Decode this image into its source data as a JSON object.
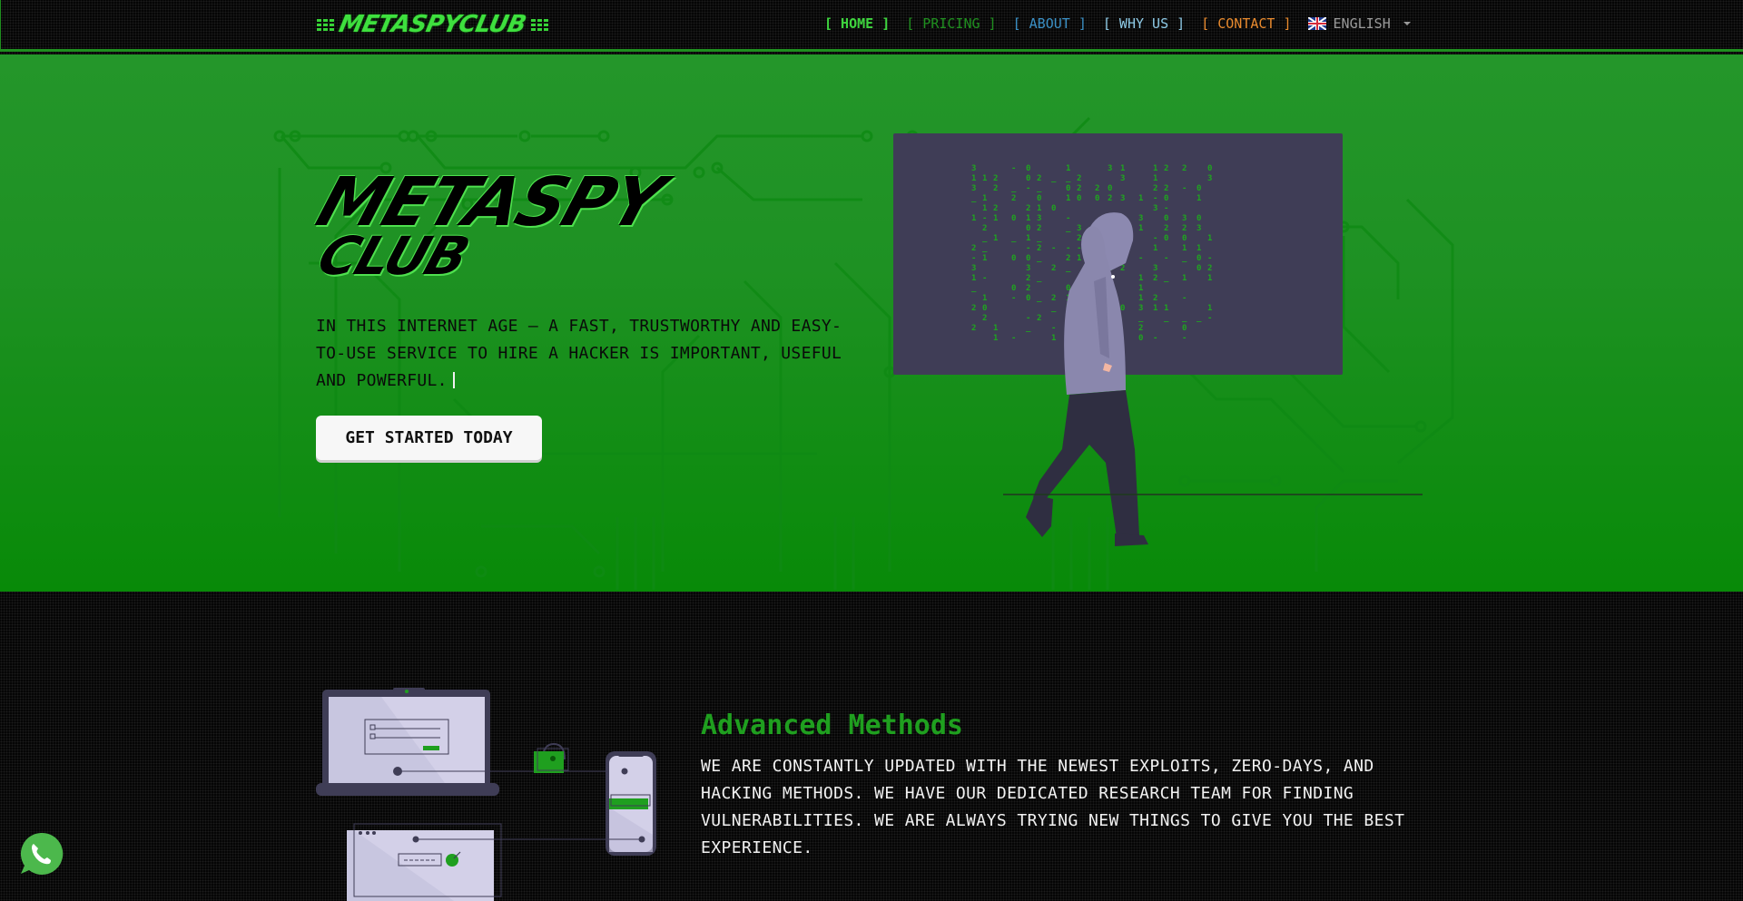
{
  "navbar": {
    "logo_text": "METASPYCLUB",
    "items": [
      {
        "label": "[ HOME ]",
        "color": "#3ed43e",
        "active": true
      },
      {
        "label": "[ PRICING ]",
        "color": "#1f8f1f"
      },
      {
        "label": "[ ABOUT ]",
        "color": "#3a8fc4"
      },
      {
        "label": "[ WHY US ]",
        "color": "#8ecae6"
      },
      {
        "label": "[ CONTACT ]",
        "color": "#e88a2e"
      }
    ],
    "language": {
      "icon": "uk-flag-icon",
      "label": "ENGLISH"
    }
  },
  "hero": {
    "logo_line1": "METASPY",
    "logo_line2": "CLUB",
    "tagline": "IN THIS INTERNET AGE – A FAST, TRUSTWORTHY AND EASY-TO-USE SERVICE TO HIRE A HACKER IS IMPORTANT, USEFUL AND POWERFUL.",
    "cta_label": "GET STARTED TODAY",
    "background_color": "#1e9123"
  },
  "features": [
    {
      "title": "Advanced Methods",
      "text": "WE ARE CONSTANTLY UPDATED WITH THE NEWEST EXPLOITS, ZERO-DAYS, AND HACKING METHODS. WE HAVE OUR DEDICATED RESEARCH TEAM FOR FINDING VULNERABILITIES. WE ARE ALWAYS TRYING NEW THINGS TO GIVE YOU THE BEST EXPERIENCE.",
      "title_color": "#1f9f1f"
    }
  ],
  "floating": {
    "whatsapp_icon": "whatsapp-icon",
    "color": "#4cb84c"
  }
}
